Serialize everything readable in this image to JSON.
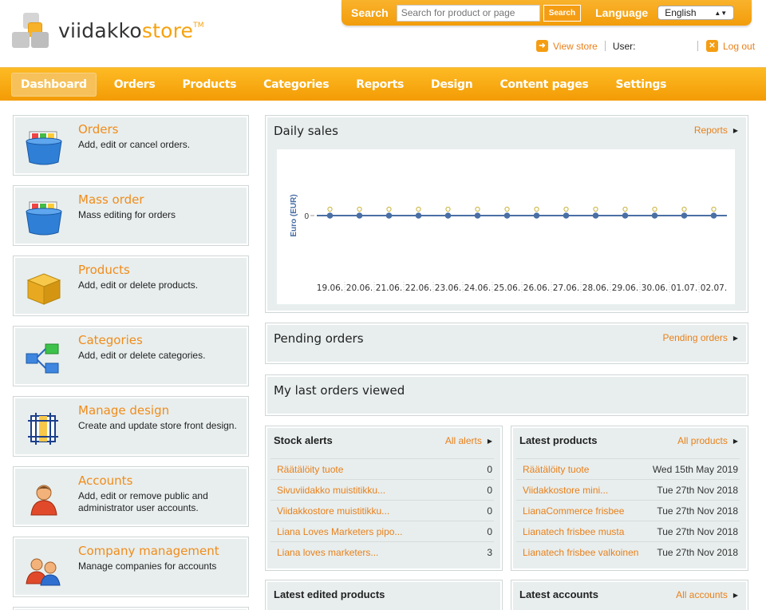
{
  "logo": {
    "brand_dark": "viidakko",
    "brand_light": "store",
    "tm": "TM"
  },
  "topbar": {
    "search_label": "Search",
    "search_placeholder": "Search for product or page",
    "search_button": "Search",
    "language_label": "Language",
    "language_value": "English"
  },
  "userbar": {
    "view_store": "View store",
    "user_label": "User:",
    "logout": "Log out"
  },
  "nav": {
    "items": [
      "Dashboard",
      "Orders",
      "Products",
      "Categories",
      "Reports",
      "Design",
      "Content pages",
      "Settings"
    ],
    "active": "Dashboard"
  },
  "cards": [
    {
      "title": "Orders",
      "desc": "Add, edit or cancel orders.",
      "icon": "orders-box-icon"
    },
    {
      "title": "Mass order",
      "desc": "Mass editing for orders",
      "icon": "mass-order-box-icon"
    },
    {
      "title": "Products",
      "desc": "Add, edit or delete products.",
      "icon": "product-package-icon"
    },
    {
      "title": "Categories",
      "desc": "Add, edit or delete categories.",
      "icon": "category-tree-icon"
    },
    {
      "title": "Manage design",
      "desc": "Create and update store front design.",
      "icon": "design-frame-icon"
    },
    {
      "title": "Accounts",
      "desc": "Add, edit or remove public and administrator user accounts.",
      "icon": "user-icon"
    },
    {
      "title": "Company management",
      "desc": "Manage companies for accounts",
      "icon": "users-group-icon"
    }
  ],
  "daily_sales": {
    "title": "Daily sales",
    "link": "Reports"
  },
  "pending_orders": {
    "title": "Pending orders",
    "link": "Pending orders"
  },
  "last_orders": {
    "title": "My last orders viewed"
  },
  "stock_alerts": {
    "title": "Stock alerts",
    "link": "All alerts",
    "rows": [
      {
        "name": "Räätälöity tuote",
        "value": "0"
      },
      {
        "name": "Sivuviidakko muistitikku...",
        "value": "0"
      },
      {
        "name": "Viidakkostore muistitikku...",
        "value": "0"
      },
      {
        "name": "Liana Loves Marketers pipo...",
        "value": "0"
      },
      {
        "name": "Liana loves marketers...",
        "value": "3"
      }
    ]
  },
  "latest_products": {
    "title": "Latest products",
    "link": "All products",
    "rows": [
      {
        "name": "Räätälöity tuote",
        "value": "Wed 15th May 2019"
      },
      {
        "name": "Viidakkostore mini...",
        "value": "Tue 27th Nov 2018"
      },
      {
        "name": "LianaCommerce frisbee",
        "value": "Tue 27th Nov 2018"
      },
      {
        "name": "Lianatech frisbee musta",
        "value": "Tue 27th Nov 2018"
      },
      {
        "name": "Lianatech frisbee valkoinen",
        "value": "Tue 27th Nov 2018"
      }
    ]
  },
  "latest_edited": {
    "title": "Latest edited products"
  },
  "latest_accounts": {
    "title": "Latest accounts",
    "link": "All accounts"
  },
  "chart_data": {
    "type": "line",
    "x": [
      "19.06.",
      "20.06.",
      "21.06.",
      "22.06.",
      "23.06.",
      "24.06.",
      "25.06.",
      "26.06.",
      "27.06.",
      "28.06.",
      "29.06.",
      "30.06.",
      "01.07.",
      "02.07."
    ],
    "series": [
      {
        "values": [
          0,
          0,
          0,
          0,
          0,
          0,
          0,
          0,
          0,
          0,
          0,
          0,
          0,
          0
        ]
      }
    ],
    "ylabel": "Euro (EUR)",
    "yticks": [
      "0"
    ],
    "line_color": "#4a6fa5",
    "marker_color": "#c8b23a"
  },
  "colors": {
    "accent": "#f49d13",
    "link": "#e8801a",
    "panel_bg": "#e8eeee"
  }
}
